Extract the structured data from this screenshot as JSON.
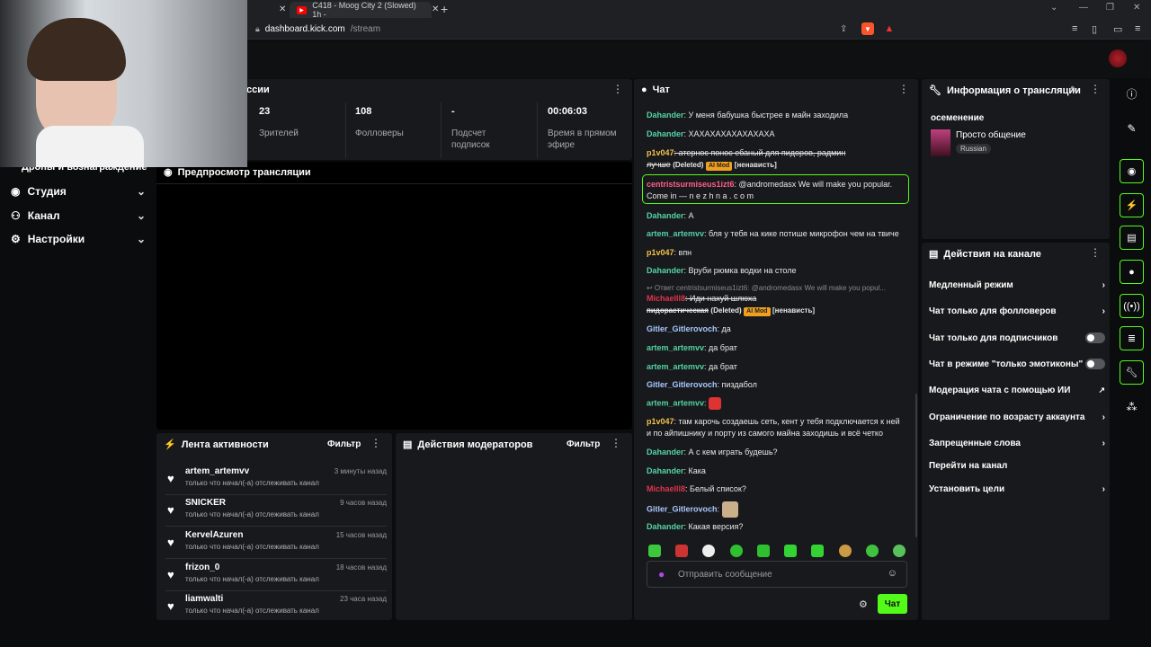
{
  "browser": {
    "tabs": [
      {
        "label": "rd"
      },
      {
        "label": "C418 - Moog City 2 (Slowed) 1h -"
      }
    ],
    "url_host": "dashboard.kick.com",
    "url_path": "/stream"
  },
  "leftnav": {
    "partial_label": "Дропы и вознаграждение",
    "items": [
      {
        "label": "Студия"
      },
      {
        "label": "Канал"
      },
      {
        "label": "Настройки"
      }
    ]
  },
  "session": {
    "title_partial": "ссии",
    "stats": [
      {
        "value": "23",
        "label": "Зрителей"
      },
      {
        "value": "108",
        "label": "Фолловеры"
      },
      {
        "value": "-",
        "label": "Подсчет подписок"
      },
      {
        "value": "00:06:03",
        "label": "Время в прямом эфире"
      }
    ]
  },
  "preview": {
    "title": "Предпросмотр трансляции"
  },
  "activity": {
    "title": "Лента активности",
    "filter": "Фильтр",
    "items": [
      {
        "name": "artem_artemvv",
        "time": "3 минуты назад",
        "desc": "только что начал(-а) отслеживать канал"
      },
      {
        "name": "SNICKER",
        "time": "9 часов назад",
        "desc": "только что начал(-а) отслеживать канал"
      },
      {
        "name": "KervelAzuren",
        "time": "15 часов назад",
        "desc": "только что начал(-а) отслеживать канал"
      },
      {
        "name": "frizon_0",
        "time": "18 часов назад",
        "desc": "только что начал(-а) отслеживать канал"
      },
      {
        "name": "liamwalti",
        "time": "23 часа назад",
        "desc": "только что начал(-а) отслеживать канал"
      }
    ]
  },
  "modactions": {
    "title": "Действия модераторов",
    "filter": "Фильтр"
  },
  "chat": {
    "title": "Чат",
    "messages": [
      {
        "user": "Dahander",
        "color": "#53d3a4",
        "text": ": У меня бабушка быстрее в майн заходила"
      },
      {
        "user": "Dahander",
        "color": "#53d3a4",
        "text": ": ХАХАХАХАХАХАХАХА"
      },
      {
        "user": "p1v047",
        "color": "#f3c14b",
        "text": ": атернос понос ебаный для пидоров, радмин",
        "text2": "лучше",
        "deleted": "(Deleted)",
        "badge": "AI Mod",
        "tag": "[ненависть]"
      },
      {
        "user": "centristsurmiseus1izt6",
        "color": "#ff5f8a",
        "text": ": @andromedasx We will make you popular.",
        "text2": "Come in — n e z h n a . c o m"
      },
      {
        "user": "Dahander",
        "color": "#53d3a4",
        "text": ": А"
      },
      {
        "user": "artem_artemvv",
        "color": "#53d3a4",
        "text": ": бля у тебя на кике потише микрофон чем на твиче"
      },
      {
        "user": "p1v047",
        "color": "#f3c14b",
        "text": ": впн"
      },
      {
        "user": "Dahander",
        "color": "#53d3a4",
        "text": ": Вруби рюмка водки на столе"
      },
      {
        "reply": "↩ Ответ centristsurmiseus1izt6: @andromedasx We will make you popul...",
        "user": "Michaelll8",
        "color": "#e0344f",
        "text": ": Иди нахуй шлюха",
        "text2": "пидорастическая",
        "deleted": "(Deleted)",
        "badge": "AI Mod",
        "tag": "[ненависть]"
      },
      {
        "user": "Gitler_Gitlerovoch",
        "color": "#a8c8ff",
        "text": ": да"
      },
      {
        "user": "artem_artemvv",
        "color": "#53d3a4",
        "text": ": да брат"
      },
      {
        "user": "artem_artemvv",
        "color": "#53d3a4",
        "text": ": да брат"
      },
      {
        "user": "Gitler_Gitlerovoch",
        "color": "#a8c8ff",
        "text": ": пиздабол"
      },
      {
        "user": "artem_artemvv",
        "color": "#53d3a4",
        "text": ":"
      },
      {
        "user": "p1v047",
        "color": "#f3c14b",
        "text": ": там карочь создаешь сеть, кент у тебя подключается к ней",
        "text2": "и по айпишнику и порту из самого майна заходишь и всё четко"
      },
      {
        "user": "Dahander",
        "color": "#53d3a4",
        "text": ": А с кем играть будешь?"
      },
      {
        "user": "Dahander",
        "color": "#53d3a4",
        "text": ": Кака"
      },
      {
        "user": "Michaelll8",
        "color": "#e0344f",
        "text": ": Белый список?"
      },
      {
        "user": "Gitler_Gitlerovoch",
        "color": "#a8c8ff",
        "text": ":"
      },
      {
        "user": "Dahander",
        "color": "#53d3a4",
        "text": ": Какая версия?"
      }
    ],
    "input_placeholder": "Отправить сообщение",
    "send_label": "Чат"
  },
  "streaminfo": {
    "title": "Информация о трансляции",
    "stream_title": "осеменение",
    "category": "Просто общение",
    "language": "Russian"
  },
  "channel_actions": {
    "title": "Действия на канале",
    "items": [
      {
        "label": "Медленный режим",
        "control": "chevron"
      },
      {
        "label": "Чат только для фолловеров",
        "control": "chevron"
      },
      {
        "label": "Чат только для подписчиков",
        "control": "toggle"
      },
      {
        "label": "Чат в режиме \"только эмотиконы\"",
        "control": "toggle"
      },
      {
        "label": "Модерация чата с помощью ИИ",
        "control": "external"
      },
      {
        "label": "Ограничение по возрасту аккаунта",
        "control": "chevron"
      },
      {
        "label": "Запрещенные слова",
        "control": "chevron"
      },
      {
        "label": "Перейти на канал",
        "control": "none"
      },
      {
        "label": "Установить цели",
        "control": "chevron"
      }
    ]
  },
  "colors": {
    "accent": "#53fc18",
    "panel": "#18191c",
    "background": "#0b0c0d"
  }
}
